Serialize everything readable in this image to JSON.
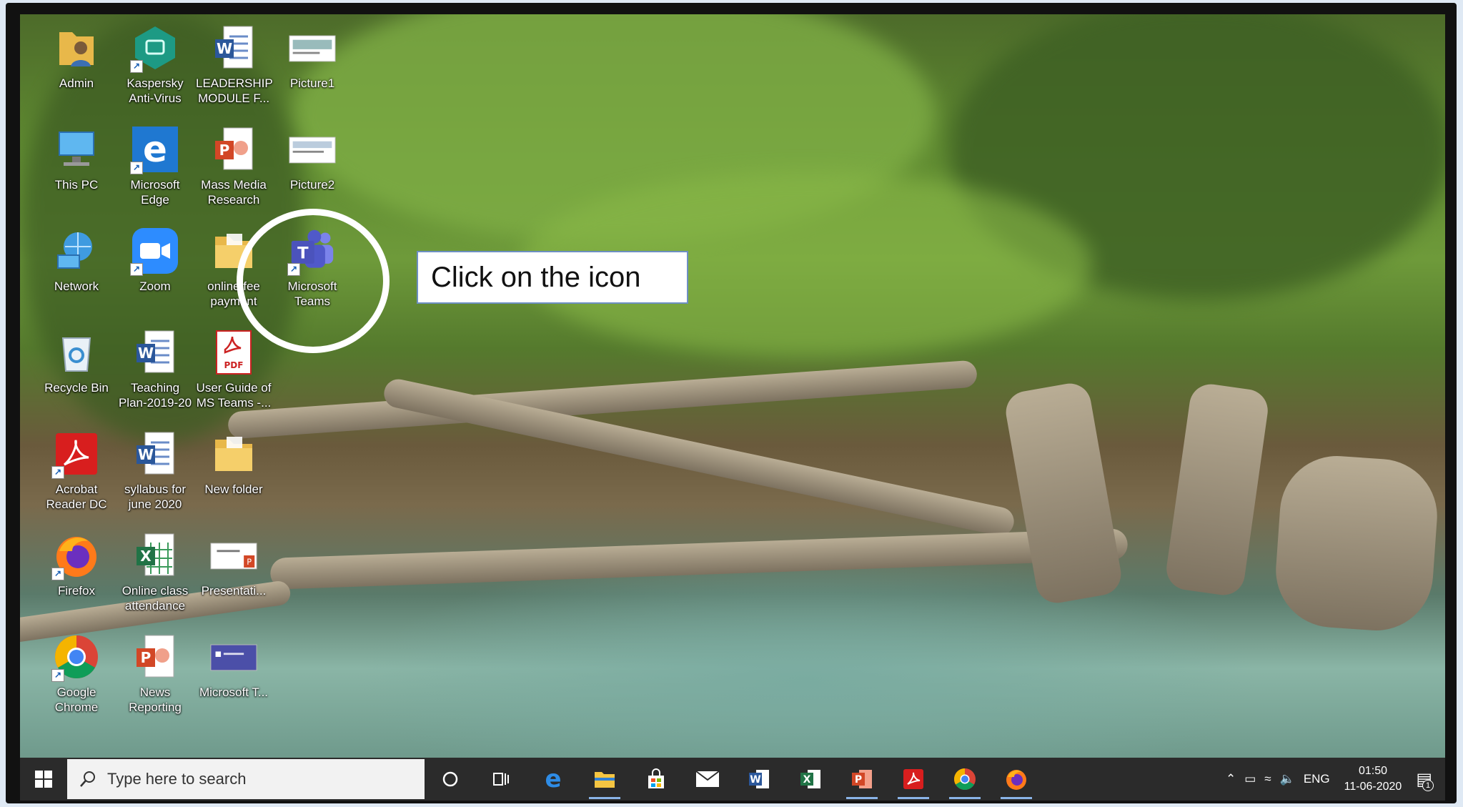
{
  "desktop_icons": [
    {
      "label": "Admin",
      "icon": "user-folder-icon"
    },
    {
      "label": "Kaspersky Anti-Virus",
      "icon": "kaspersky-icon"
    },
    {
      "label": "LEADERSHIP MODULE F...",
      "icon": "word-document-icon"
    },
    {
      "label": "Picture1",
      "icon": "image-file-icon"
    },
    {
      "label": "This PC",
      "icon": "computer-icon"
    },
    {
      "label": "Microsoft Edge",
      "icon": "edge-icon"
    },
    {
      "label": "Mass Media Research",
      "icon": "powerpoint-document-icon"
    },
    {
      "label": "Picture2",
      "icon": "image-file-icon"
    },
    {
      "label": "Network",
      "icon": "network-icon"
    },
    {
      "label": "Zoom",
      "icon": "zoom-icon"
    },
    {
      "label": "online fee payment",
      "icon": "folder-icon"
    },
    {
      "label": "Microsoft Teams",
      "icon": "teams-icon"
    },
    {
      "label": "Recycle Bin",
      "icon": "recycle-bin-icon"
    },
    {
      "label": "Teaching Plan-2019-20",
      "icon": "word-document-icon"
    },
    {
      "label": "User Guide of MS Teams -...",
      "icon": "pdf-document-icon"
    },
    {
      "label": "Acrobat Reader DC",
      "icon": "acrobat-icon"
    },
    {
      "label": "syllabus for june 2020",
      "icon": "word-document-icon"
    },
    {
      "label": "New folder",
      "icon": "folder-icon"
    },
    {
      "label": "Firefox",
      "icon": "firefox-icon"
    },
    {
      "label": "Online class attendance",
      "icon": "excel-document-icon"
    },
    {
      "label": "Presentati...",
      "icon": "presentation-thumbnail-icon"
    },
    {
      "label": "Google Chrome",
      "icon": "chrome-icon"
    },
    {
      "label": "News Reporting",
      "icon": "powerpoint-document-icon"
    },
    {
      "label": "Microsoft T...",
      "icon": "teams-thumbnail-icon"
    }
  ],
  "callout": {
    "text": "Click on the icon"
  },
  "taskbar": {
    "search_placeholder": "Type here to search",
    "pinned": [
      {
        "name": "cortana-icon"
      },
      {
        "name": "task-view-icon"
      },
      {
        "name": "edge-icon"
      },
      {
        "name": "file-explorer-icon"
      },
      {
        "name": "store-icon"
      },
      {
        "name": "mail-icon"
      },
      {
        "name": "word-icon"
      },
      {
        "name": "excel-icon"
      },
      {
        "name": "powerpoint-icon"
      },
      {
        "name": "acrobat-icon"
      },
      {
        "name": "chrome-icon"
      },
      {
        "name": "firefox-icon"
      }
    ],
    "tray": {
      "language": "ENG",
      "time": "01:50",
      "date": "11-06-2020",
      "notification_count": "1"
    }
  },
  "colors": {
    "taskbar": "#2b2b2b",
    "callout_border": "#6d8fc2",
    "teams": "#5059c9",
    "edge": "#1f78d1",
    "zoom": "#2d8cff"
  }
}
